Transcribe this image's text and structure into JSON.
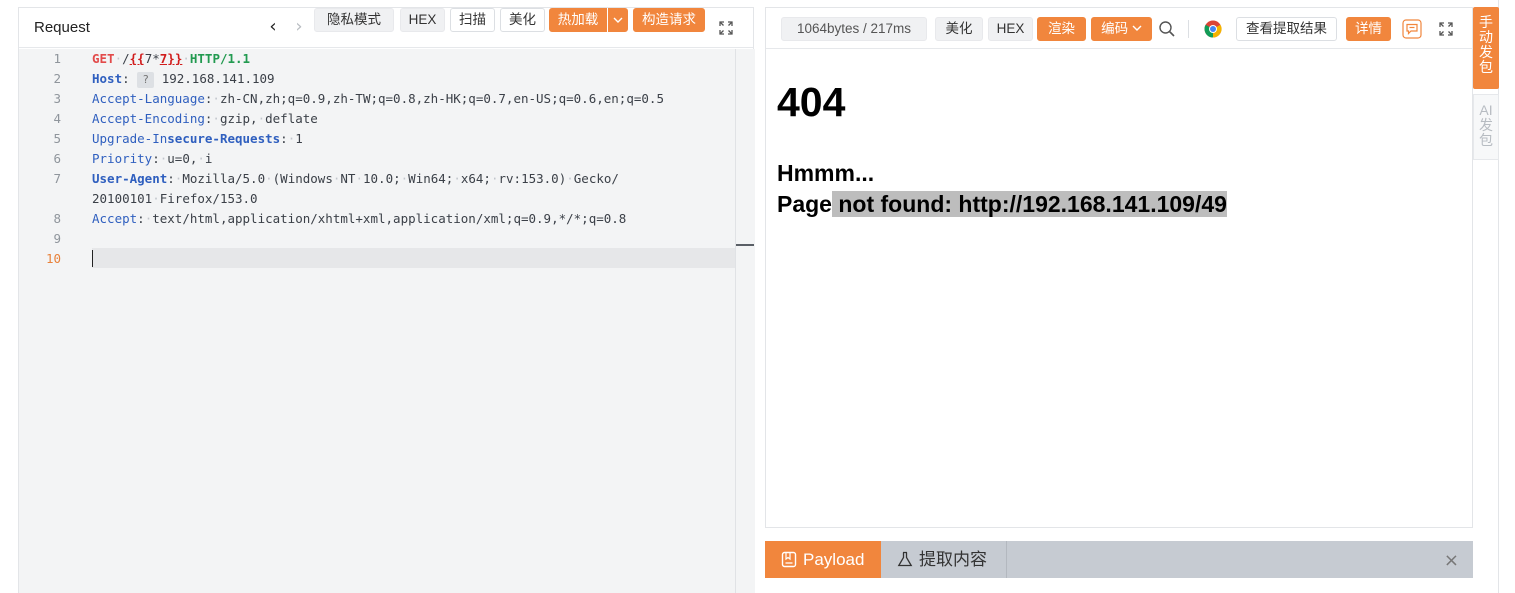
{
  "request": {
    "title": "Request",
    "toolbar": {
      "privacy_mode": "隐私模式",
      "hex": "HEX",
      "scan": "扫描",
      "beautify": "美化",
      "hot_load": "热加载",
      "build_request": "构造请求"
    },
    "code": {
      "line_numbers": [
        "1",
        "2",
        "3",
        "4",
        "5",
        "6",
        "7",
        "",
        "8",
        "9",
        "10"
      ],
      "l1_method": "GET",
      "l1_path": "/",
      "l1_tpl_open": "{{",
      "l1_tpl_expr": "7*",
      "l1_tpl_close": "7}}",
      "l1_proto": "HTTP/1.1",
      "l2_key": "Host",
      "l2_q": "?",
      "l2_val": "192.168.141.109",
      "l3_key": "Accept-Language",
      "l3_val": "zh-CN,zh;q=0.9,zh-TW;q=0.8,zh-HK;q=0.7,en-US;q=0.6,en;q=0.5",
      "l4_key": "Accept-Encoding",
      "l4_val1": "gzip,",
      "l4_val2": "deflate",
      "l5_key_a": "Upgrade-In",
      "l5_key_b": "secure-Requests",
      "l5_val": "1",
      "l6_key": "Priority",
      "l6_val1": "u=0,",
      "l6_val2": "i",
      "l7_key": "User-Agent",
      "l7_v1": "Mozilla/5.0",
      "l7_v2": "(Windows",
      "l7_v3": "NT",
      "l7_v4": "10.0;",
      "l7_v5": "Win64;",
      "l7_v6": "x64;",
      "l7_v7": "rv:153.0)",
      "l7_v8": "Gecko/",
      "l7b_v1": "20100101",
      "l7b_v2": "Firefox/153.0",
      "l8_key": "Accept",
      "l8_val": "text/html,application/xhtml+xml,application/xml;q=0.9,*/*;q=0.8"
    }
  },
  "response": {
    "stats": "1064bytes / 217ms",
    "toolbar": {
      "beautify": "美化",
      "hex": "HEX",
      "render": "渲染",
      "encoding": "编码",
      "view_extract": "查看提取结果",
      "details": "详情"
    },
    "body": {
      "heading": "404",
      "line1": "Hmmm...",
      "line2_plain": "Page",
      "line2_highlight": " not found: http://192.168.141.109/49"
    }
  },
  "bottom_tabs": {
    "payload": "Payload",
    "extract": "提取内容"
  },
  "side_tabs": {
    "manual_send": "手动发包",
    "ai_send": "AI发包"
  },
  "colors": {
    "accent": "#f1863d",
    "method": "#e24a4a",
    "header_key": "#2f5fbf",
    "protocol": "#229a50"
  }
}
